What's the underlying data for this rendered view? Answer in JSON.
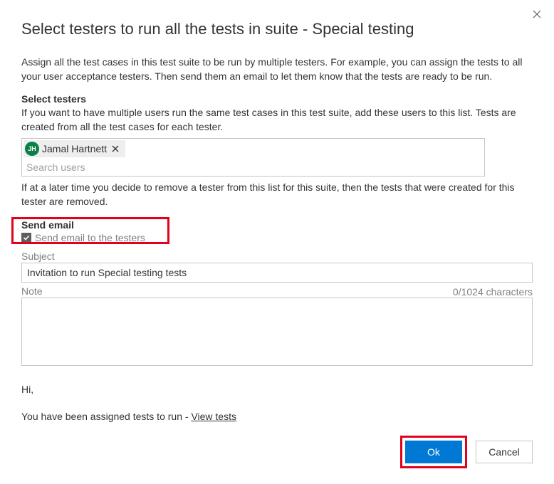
{
  "dialog": {
    "title": "Select testers to run all the tests in suite - Special testing",
    "intro": "Assign all the test cases in this test suite to be run by multiple testers. For example, you can assign the tests to all your user acceptance testers. Then send them an email to let them know that the tests are ready to be run."
  },
  "testers": {
    "section_label": "Select testers",
    "help": "If you want to have multiple users run the same test cases in this test suite, add these users to this list. Tests are created from all the test cases for each tester.",
    "chips": [
      {
        "initials": "JH",
        "name": "Jamal Hartnett"
      }
    ],
    "search_placeholder": "Search users",
    "after_note": "If at a later time you decide to remove a tester from this list for this suite, then the tests that were created for this tester are removed."
  },
  "email": {
    "section_label": "Send email",
    "checkbox_label": "Send email to the testers",
    "checked": true,
    "subject_label": "Subject",
    "subject_value": "Invitation to run Special testing tests",
    "note_label": "Note",
    "char_count": "0/1024 characters",
    "note_value": ""
  },
  "preview": {
    "greeting": "Hi,",
    "body": "You have been assigned tests to run - ",
    "link_text": "View tests"
  },
  "buttons": {
    "ok": "Ok",
    "cancel": "Cancel"
  }
}
